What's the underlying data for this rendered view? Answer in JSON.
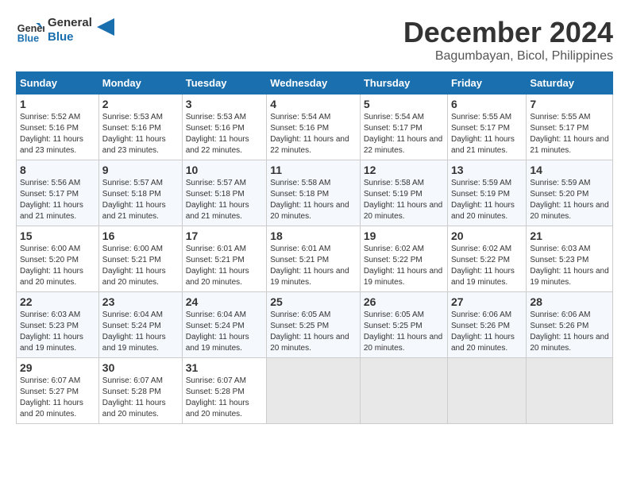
{
  "logo": {
    "line1": "General",
    "line2": "Blue"
  },
  "title": "December 2024",
  "subtitle": "Bagumbayan, Bicol, Philippines",
  "weekdays": [
    "Sunday",
    "Monday",
    "Tuesday",
    "Wednesday",
    "Thursday",
    "Friday",
    "Saturday"
  ],
  "weeks": [
    [
      {
        "day": "1",
        "sunrise": "5:52 AM",
        "sunset": "5:16 PM",
        "daylight": "11 hours and 23 minutes."
      },
      {
        "day": "2",
        "sunrise": "5:53 AM",
        "sunset": "5:16 PM",
        "daylight": "11 hours and 23 minutes."
      },
      {
        "day": "3",
        "sunrise": "5:53 AM",
        "sunset": "5:16 PM",
        "daylight": "11 hours and 22 minutes."
      },
      {
        "day": "4",
        "sunrise": "5:54 AM",
        "sunset": "5:16 PM",
        "daylight": "11 hours and 22 minutes."
      },
      {
        "day": "5",
        "sunrise": "5:54 AM",
        "sunset": "5:17 PM",
        "daylight": "11 hours and 22 minutes."
      },
      {
        "day": "6",
        "sunrise": "5:55 AM",
        "sunset": "5:17 PM",
        "daylight": "11 hours and 21 minutes."
      },
      {
        "day": "7",
        "sunrise": "5:55 AM",
        "sunset": "5:17 PM",
        "daylight": "11 hours and 21 minutes."
      }
    ],
    [
      {
        "day": "8",
        "sunrise": "5:56 AM",
        "sunset": "5:17 PM",
        "daylight": "11 hours and 21 minutes."
      },
      {
        "day": "9",
        "sunrise": "5:57 AM",
        "sunset": "5:18 PM",
        "daylight": "11 hours and 21 minutes."
      },
      {
        "day": "10",
        "sunrise": "5:57 AM",
        "sunset": "5:18 PM",
        "daylight": "11 hours and 21 minutes."
      },
      {
        "day": "11",
        "sunrise": "5:58 AM",
        "sunset": "5:18 PM",
        "daylight": "11 hours and 20 minutes."
      },
      {
        "day": "12",
        "sunrise": "5:58 AM",
        "sunset": "5:19 PM",
        "daylight": "11 hours and 20 minutes."
      },
      {
        "day": "13",
        "sunrise": "5:59 AM",
        "sunset": "5:19 PM",
        "daylight": "11 hours and 20 minutes."
      },
      {
        "day": "14",
        "sunrise": "5:59 AM",
        "sunset": "5:20 PM",
        "daylight": "11 hours and 20 minutes."
      }
    ],
    [
      {
        "day": "15",
        "sunrise": "6:00 AM",
        "sunset": "5:20 PM",
        "daylight": "11 hours and 20 minutes."
      },
      {
        "day": "16",
        "sunrise": "6:00 AM",
        "sunset": "5:21 PM",
        "daylight": "11 hours and 20 minutes."
      },
      {
        "day": "17",
        "sunrise": "6:01 AM",
        "sunset": "5:21 PM",
        "daylight": "11 hours and 20 minutes."
      },
      {
        "day": "18",
        "sunrise": "6:01 AM",
        "sunset": "5:21 PM",
        "daylight": "11 hours and 19 minutes."
      },
      {
        "day": "19",
        "sunrise": "6:02 AM",
        "sunset": "5:22 PM",
        "daylight": "11 hours and 19 minutes."
      },
      {
        "day": "20",
        "sunrise": "6:02 AM",
        "sunset": "5:22 PM",
        "daylight": "11 hours and 19 minutes."
      },
      {
        "day": "21",
        "sunrise": "6:03 AM",
        "sunset": "5:23 PM",
        "daylight": "11 hours and 19 minutes."
      }
    ],
    [
      {
        "day": "22",
        "sunrise": "6:03 AM",
        "sunset": "5:23 PM",
        "daylight": "11 hours and 19 minutes."
      },
      {
        "day": "23",
        "sunrise": "6:04 AM",
        "sunset": "5:24 PM",
        "daylight": "11 hours and 19 minutes."
      },
      {
        "day": "24",
        "sunrise": "6:04 AM",
        "sunset": "5:24 PM",
        "daylight": "11 hours and 19 minutes."
      },
      {
        "day": "25",
        "sunrise": "6:05 AM",
        "sunset": "5:25 PM",
        "daylight": "11 hours and 20 minutes."
      },
      {
        "day": "26",
        "sunrise": "6:05 AM",
        "sunset": "5:25 PM",
        "daylight": "11 hours and 20 minutes."
      },
      {
        "day": "27",
        "sunrise": "6:06 AM",
        "sunset": "5:26 PM",
        "daylight": "11 hours and 20 minutes."
      },
      {
        "day": "28",
        "sunrise": "6:06 AM",
        "sunset": "5:26 PM",
        "daylight": "11 hours and 20 minutes."
      }
    ],
    [
      {
        "day": "29",
        "sunrise": "6:07 AM",
        "sunset": "5:27 PM",
        "daylight": "11 hours and 20 minutes."
      },
      {
        "day": "30",
        "sunrise": "6:07 AM",
        "sunset": "5:28 PM",
        "daylight": "11 hours and 20 minutes."
      },
      {
        "day": "31",
        "sunrise": "6:07 AM",
        "sunset": "5:28 PM",
        "daylight": "11 hours and 20 minutes."
      },
      null,
      null,
      null,
      null
    ]
  ]
}
